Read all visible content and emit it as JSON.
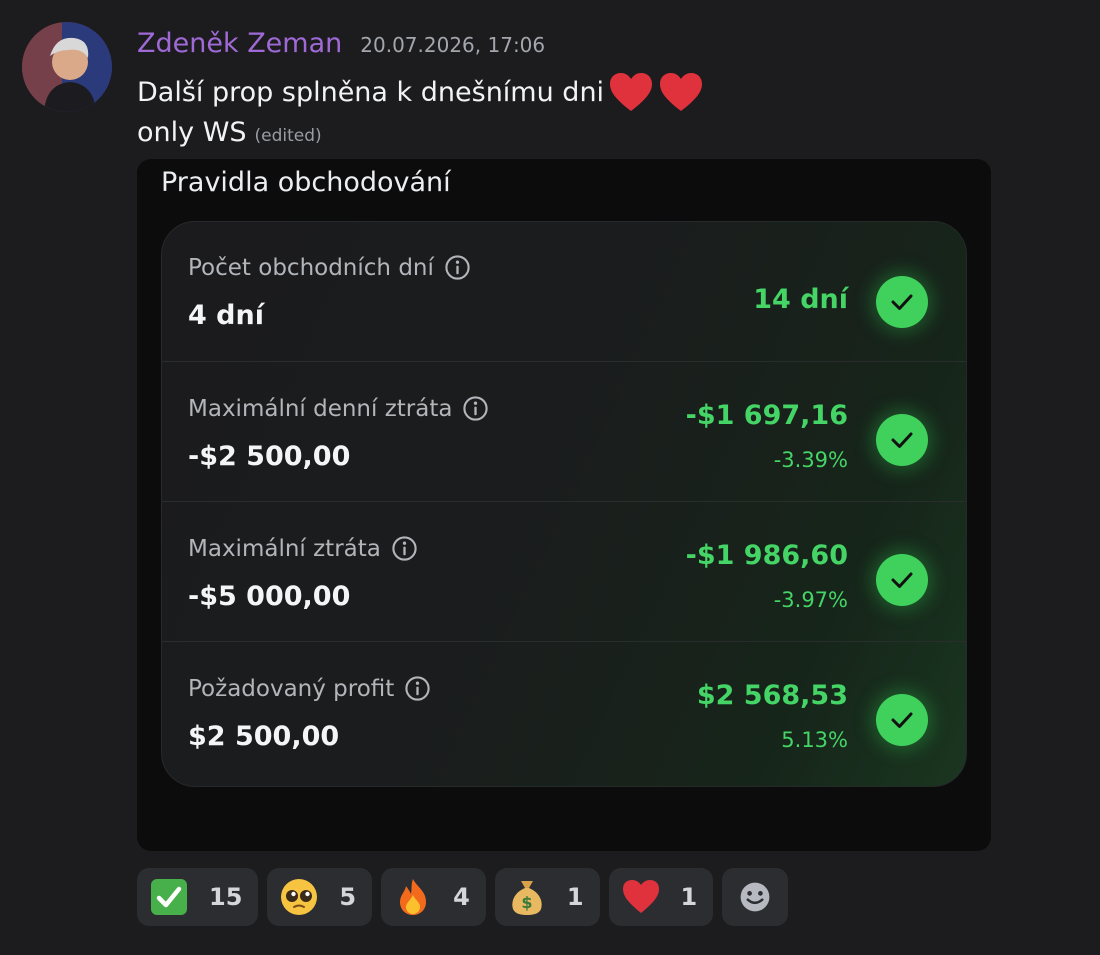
{
  "message": {
    "author": "Zdeněk Zeman",
    "timestamp": "20.07.2026, 17:06",
    "line1": "Další prop splněna k dnešnímu dni",
    "line1_emojis": [
      "red-heart",
      "red-heart"
    ],
    "line2": "only WS",
    "edited_label": "(edited)"
  },
  "attachment": {
    "title": "Pravidla obchodování",
    "rules": [
      {
        "label": "Počet obchodních dní",
        "limit": "4 dní",
        "value": "14 dní",
        "percent": "",
        "status": "passed"
      },
      {
        "label": "Maximální denní ztráta",
        "limit": "-$2 500,00",
        "value": "-$1 697,16",
        "percent": "-3.39%",
        "status": "passed"
      },
      {
        "label": "Maximální ztráta",
        "limit": "-$5 000,00",
        "value": "-$1 986,60",
        "percent": "-3.97%",
        "status": "passed"
      },
      {
        "label": "Požadovaný profit",
        "limit": "$2 500,00",
        "value": "$2 568,53",
        "percent": "5.13%",
        "status": "passed"
      }
    ],
    "accent_color": "#45d466"
  },
  "reactions": [
    {
      "emoji": "white-check-mark",
      "count": "15"
    },
    {
      "emoji": "pleading-face",
      "count": "5"
    },
    {
      "emoji": "fire",
      "count": "4"
    },
    {
      "emoji": "money-bag",
      "count": "1"
    },
    {
      "emoji": "red-heart",
      "count": "1"
    }
  ],
  "colors": {
    "background": "#1c1c1f",
    "author": "#a06ad6",
    "reaction_bg": "#2b2d31"
  }
}
